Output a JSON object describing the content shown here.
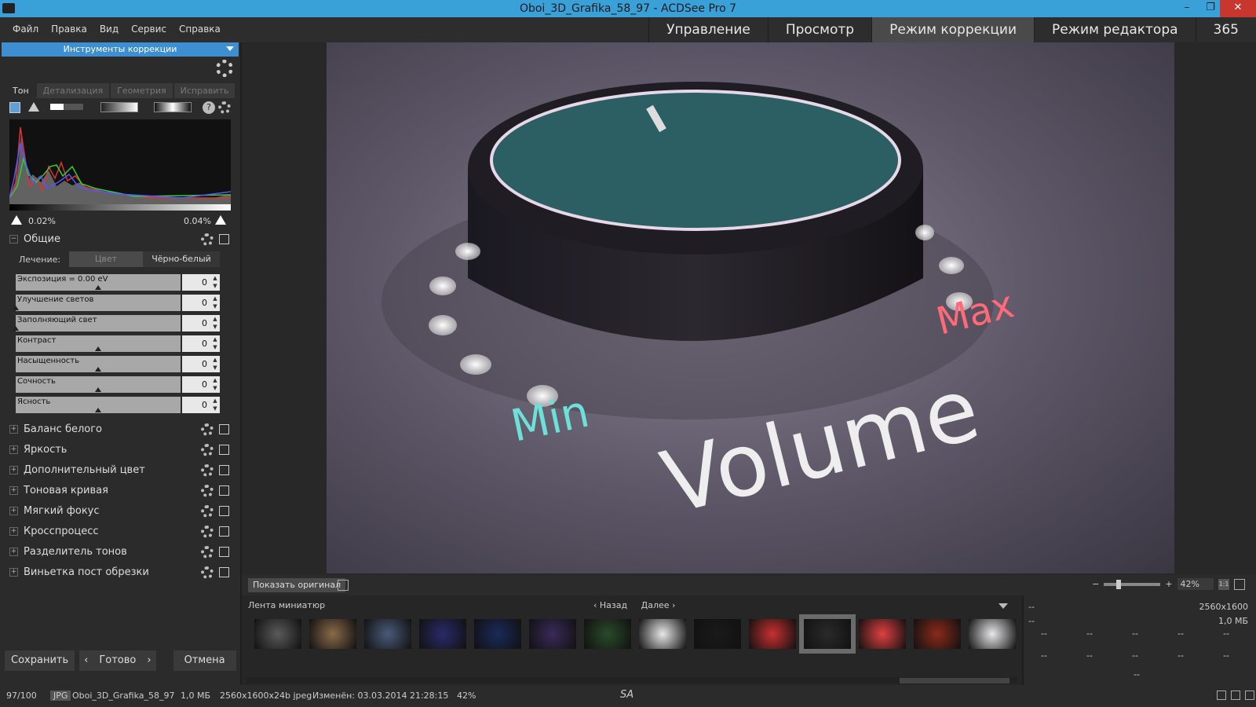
{
  "window": {
    "title": "Oboi_3D_Grafika_58_97 - ACDSee Pro 7",
    "minimize": "–",
    "restore": "❐",
    "close": "✕"
  },
  "menu": [
    "Файл",
    "Правка",
    "Вид",
    "Сервис",
    "Справка"
  ],
  "modes": [
    {
      "label": "Управление",
      "active": false
    },
    {
      "label": "Просмотр",
      "active": false
    },
    {
      "label": "Режим коррекции",
      "active": true
    },
    {
      "label": "Режим редактора",
      "active": false
    },
    {
      "label": "365",
      "active": false
    }
  ],
  "panel": {
    "title": "Инструменты коррекции",
    "tabs": [
      "Тон",
      "Детализация",
      "Геометрия",
      "Исправить"
    ],
    "clip_left": "0.02%",
    "clip_right": "0.04%",
    "general": {
      "label": "Общие",
      "treatment_label": "Лечение:",
      "color_option": "Цвет",
      "bw_option": "Чёрно-белый"
    },
    "sliders": [
      {
        "label": "Экспозиция = 0.00 eV",
        "value": "0",
        "level": 0.5
      },
      {
        "label": "Улучшение светов",
        "value": "0",
        "level": 0.0
      },
      {
        "label": "Заполняющий свет",
        "value": "0",
        "level": 0.0
      },
      {
        "label": "Контраст",
        "value": "0",
        "level": 0.5
      },
      {
        "label": "Насыщенность",
        "value": "0",
        "level": 0.5
      },
      {
        "label": "Сочность",
        "value": "0",
        "level": 0.5
      },
      {
        "label": "Ясность",
        "value": "0",
        "level": 0.5
      }
    ],
    "sections": [
      "Баланс белого",
      "Яркость",
      "Дополнительный цвет",
      "Тоновая кривая",
      "Мягкий фокус",
      "Кросспроцесс",
      "Разделитель тонов",
      "Виньетка пост обрезки"
    ],
    "buttons": {
      "save": "Сохранить",
      "prev": "‹",
      "done": "Готово",
      "next": "›",
      "cancel": "Отмена"
    }
  },
  "viewer": {
    "image_text_min": "Min",
    "image_text_max": "Max",
    "image_text_volume": "Volume",
    "show_original": "Показать оригинал",
    "zoom": "42%"
  },
  "filmstrip": {
    "title": "Лента миниатюр",
    "back": "Назад",
    "forward": "Далее",
    "thumb_colors": [
      "#5a5a5a",
      "#8a6a4a",
      "#4a5a7a",
      "#2a2a6a",
      "#1a2a5a",
      "#3a2a5a",
      "#2a4a2a",
      "#e8e8e8",
      "#1a1a1a",
      "#c83030",
      "#2a2a2a",
      "#e04040",
      "#8a2a1a",
      "#e8e8ea"
    ],
    "selected_index": 10
  },
  "info": {
    "dim1": "--",
    "resolution": "2560x1600",
    "dim2": "--",
    "size": "1,0 МБ",
    "cells": [
      "--",
      "--",
      "--",
      "--",
      "--",
      "--",
      "--",
      "--",
      "--",
      "--"
    ],
    "bottom": "--"
  },
  "status": {
    "count": "97/100",
    "format": "JPG",
    "filename": "Oboi_3D_Grafika_58_97",
    "filesize": "1,0 МБ",
    "dims": "2560x1600x24b jpeg",
    "modified": "Изменён: 03.03.2014 21:28:15",
    "zoom": "42%",
    "tag": "SA"
  }
}
